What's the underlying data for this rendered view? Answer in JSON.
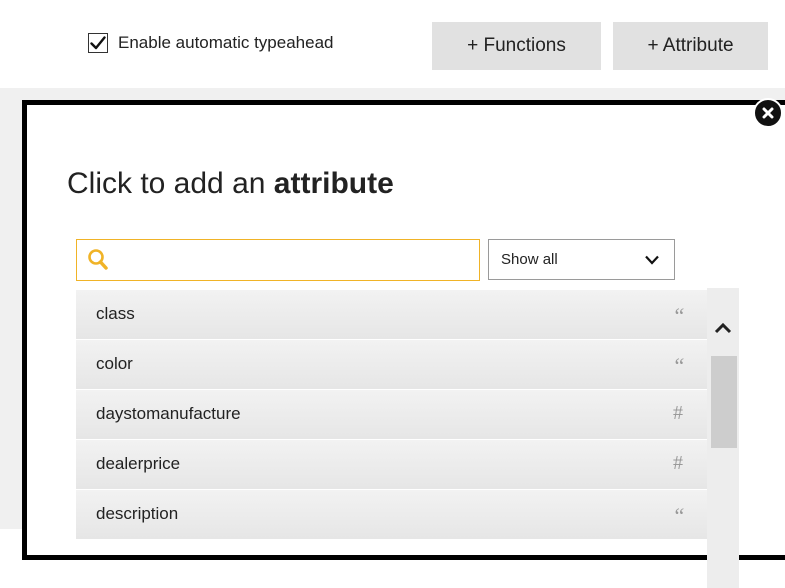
{
  "toolbar": {
    "typeahead_checked": true,
    "typeahead_label": "Enable automatic typeahead",
    "functions_label": "+ Functions",
    "attribute_label": "+ Attribute"
  },
  "modal": {
    "title_prefix": "Click to add an",
    "title_bold": "attribute",
    "search": {
      "value": "",
      "placeholder": ""
    },
    "filter": {
      "selected": "Show all"
    },
    "attributes": [
      {
        "name": "class",
        "type_symbol": "“",
        "type_icon": "text-quote-icon"
      },
      {
        "name": "color",
        "type_symbol": "“",
        "type_icon": "text-quote-icon"
      },
      {
        "name": "daystomanufacture",
        "type_symbol": "#",
        "type_icon": "number-hash-icon"
      },
      {
        "name": "dealerprice",
        "type_symbol": "#",
        "type_icon": "number-hash-icon"
      },
      {
        "name": "description",
        "type_symbol": "“",
        "type_icon": "text-quote-icon"
      }
    ]
  },
  "colors": {
    "search_border": "#f0b327",
    "button_bg": "#e1e1e1",
    "row_bg": "#eeeeee",
    "modal_border": "#000000"
  }
}
